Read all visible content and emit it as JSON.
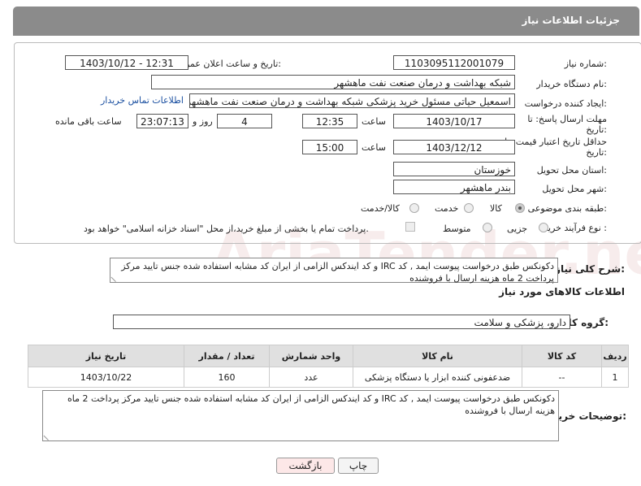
{
  "page_title": "جزئیات اطلاعات نیاز",
  "form": {
    "need_number": {
      "label": "شماره نیاز:",
      "value": "1103095112001079"
    },
    "announce": {
      "label": "تاریخ و ساعت اعلان عمومی:",
      "value": "1403/10/12 - 12:31"
    },
    "buyer_org": {
      "label": "نام دستگاه خریدار:",
      "value": "شبکه بهداشت و درمان صنعت نفت ماهشهر"
    },
    "creator": {
      "label": "ایجاد کننده درخواست:",
      "value": "اسمعیل حیاتی مسئول خرید پزشکی شبکه بهداشت و درمان صنعت نفت ماهشهر",
      "contact_link": "اطلاعات تماس خریدار"
    },
    "reply_deadline": {
      "label": "مهلت ارسال پاسخ: تا تاریخ:",
      "date": "1403/10/17",
      "time_label": "ساعت",
      "time": "12:35",
      "days": "4",
      "days_label": "روز و",
      "remaining": "23:07:13",
      "remaining_label": "ساعت باقی مانده"
    },
    "price_validity": {
      "label": "حداقل تاریخ اعتبار قیمت: تا تاریخ:",
      "date": "1403/12/12",
      "time_label": "ساعت",
      "time": "15:00"
    },
    "province": {
      "label": "استان محل تحویل:",
      "value": "خوزستان"
    },
    "city": {
      "label": "شهر محل تحویل:",
      "value": "بندر ماهشهر"
    },
    "category": {
      "label": "طبقه بندی موضوعی:",
      "options": [
        "کالا",
        "خدمت",
        "کالا/خدمت"
      ]
    },
    "purchase_type": {
      "label": "نوع فرآیند خرید :",
      "options": [
        "جزیی",
        "متوسط"
      ],
      "payment_note": "پرداخت تمام یا بخشی از مبلغ خرید،از محل \"اسناد خزانه اسلامی\" خواهد بود."
    }
  },
  "description": {
    "label": "شرح کلی نیاز:",
    "text": "دکونکس طبق درخواست پیوست ایمد , کد IRC و کد ایندکس الزامی از ایران کد مشابه استفاده شده جنس تایید مرکز پرداخت 2 ماه هزینه ارسال با فروشنده"
  },
  "goods_info_title": "اطلاعات کالاهای مورد نیاز",
  "goods_group": {
    "label": "گروه کالا:",
    "value": "دارو، پزشکی و سلامت"
  },
  "table": {
    "headers": [
      "ردیف",
      "کد کالا",
      "نام کالا",
      "واحد شمارش",
      "تعداد / مقدار",
      "تاریخ نیاز"
    ],
    "rows": [
      [
        "1",
        "--",
        "ضدعفونی کننده ابزار یا دستگاه پزشکی",
        "عدد",
        "160",
        "1403/10/22"
      ]
    ]
  },
  "buyer_notes": {
    "label": "توضیحات خریدار:",
    "text": "دکونکس طبق درخواست پیوست ایمد , کد IRC و کد ایندکس الزامی از ایران کد مشابه استفاده شده جنس تایید مرکز پرداخت 2 ماه هزینه ارسال با فروشنده"
  },
  "buttons": {
    "print": "چاپ",
    "back": "بازگشت"
  },
  "colors": {
    "header_bg": "#8b8b8b",
    "back_button_bg": "#fde8e8",
    "link": "#1a4fa0"
  }
}
